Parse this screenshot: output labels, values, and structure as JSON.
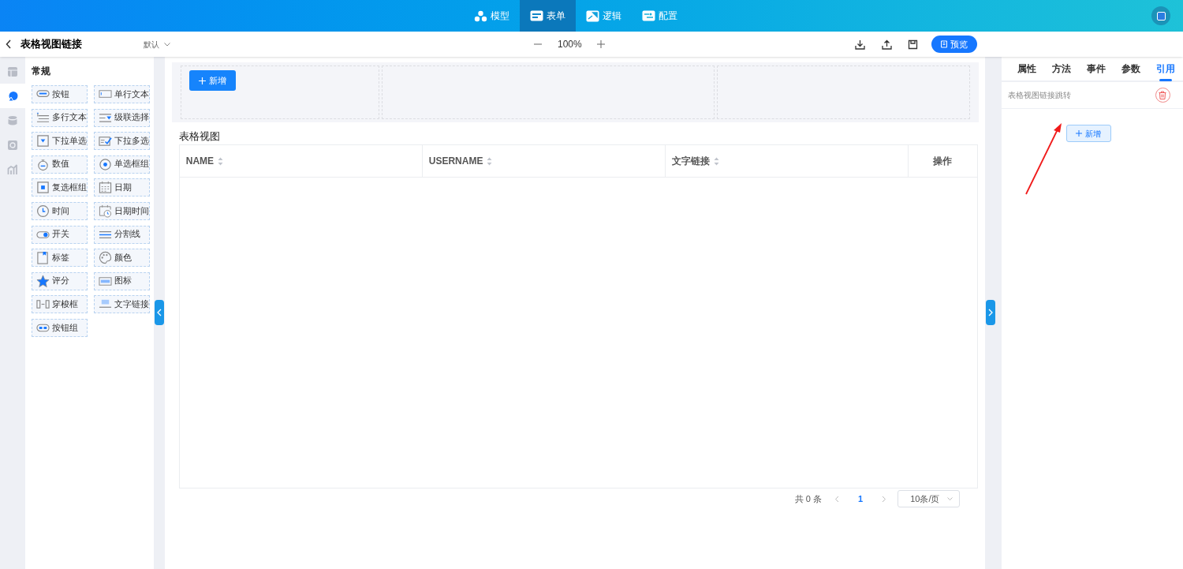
{
  "topbar": {
    "tabs": [
      {
        "label": "模型",
        "selected": false
      },
      {
        "label": "表单",
        "selected": true
      },
      {
        "label": "逻辑",
        "selected": false
      },
      {
        "label": "配置",
        "selected": false
      }
    ]
  },
  "toolbar": {
    "title": "表格视图链接",
    "version": "默认",
    "zoom": "100%",
    "preview_button": "预览"
  },
  "left_rail": [
    {
      "selected": false
    },
    {
      "selected": true
    },
    {
      "selected": false
    },
    {
      "selected": false
    },
    {
      "selected": false
    }
  ],
  "components": {
    "heading": "常规",
    "items": [
      {
        "label": "按钮"
      },
      {
        "label": "单行文本"
      },
      {
        "label": "多行文本"
      },
      {
        "label": "级联选择"
      },
      {
        "label": "下拉单选"
      },
      {
        "label": "下拉多选"
      },
      {
        "label": "数值"
      },
      {
        "label": "单选框组"
      },
      {
        "label": "复选框组"
      },
      {
        "label": "日期"
      },
      {
        "label": "时间"
      },
      {
        "label": "日期时间"
      },
      {
        "label": "开关"
      },
      {
        "label": "分割线"
      },
      {
        "label": "标签"
      },
      {
        "label": "颜色"
      },
      {
        "label": "评分"
      },
      {
        "label": "图标"
      },
      {
        "label": "穿梭框"
      },
      {
        "label": "文字链接"
      },
      {
        "label": "按钮组"
      }
    ]
  },
  "canvas": {
    "add_button": "新增",
    "table": {
      "title": "表格视图",
      "columns": [
        {
          "label": "NAME",
          "sortable": true
        },
        {
          "label": "USERNAME",
          "sortable": true
        },
        {
          "label": "文字链接",
          "sortable": true
        },
        {
          "label": "操作",
          "sortable": false
        }
      ]
    },
    "pagination": {
      "total": "共 0 条",
      "pages": [
        {
          "label": "1",
          "selected": true
        }
      ],
      "page_size": "10条/页"
    }
  },
  "right_panel": {
    "tabs": [
      {
        "label": "属性",
        "selected": false
      },
      {
        "label": "方法",
        "selected": false
      },
      {
        "label": "事件",
        "selected": false
      },
      {
        "label": "参数",
        "selected": false
      },
      {
        "label": "引用",
        "selected": true
      }
    ],
    "references": [
      {
        "label": "表格视图链接跳转"
      }
    ],
    "add_button": "新增"
  }
}
